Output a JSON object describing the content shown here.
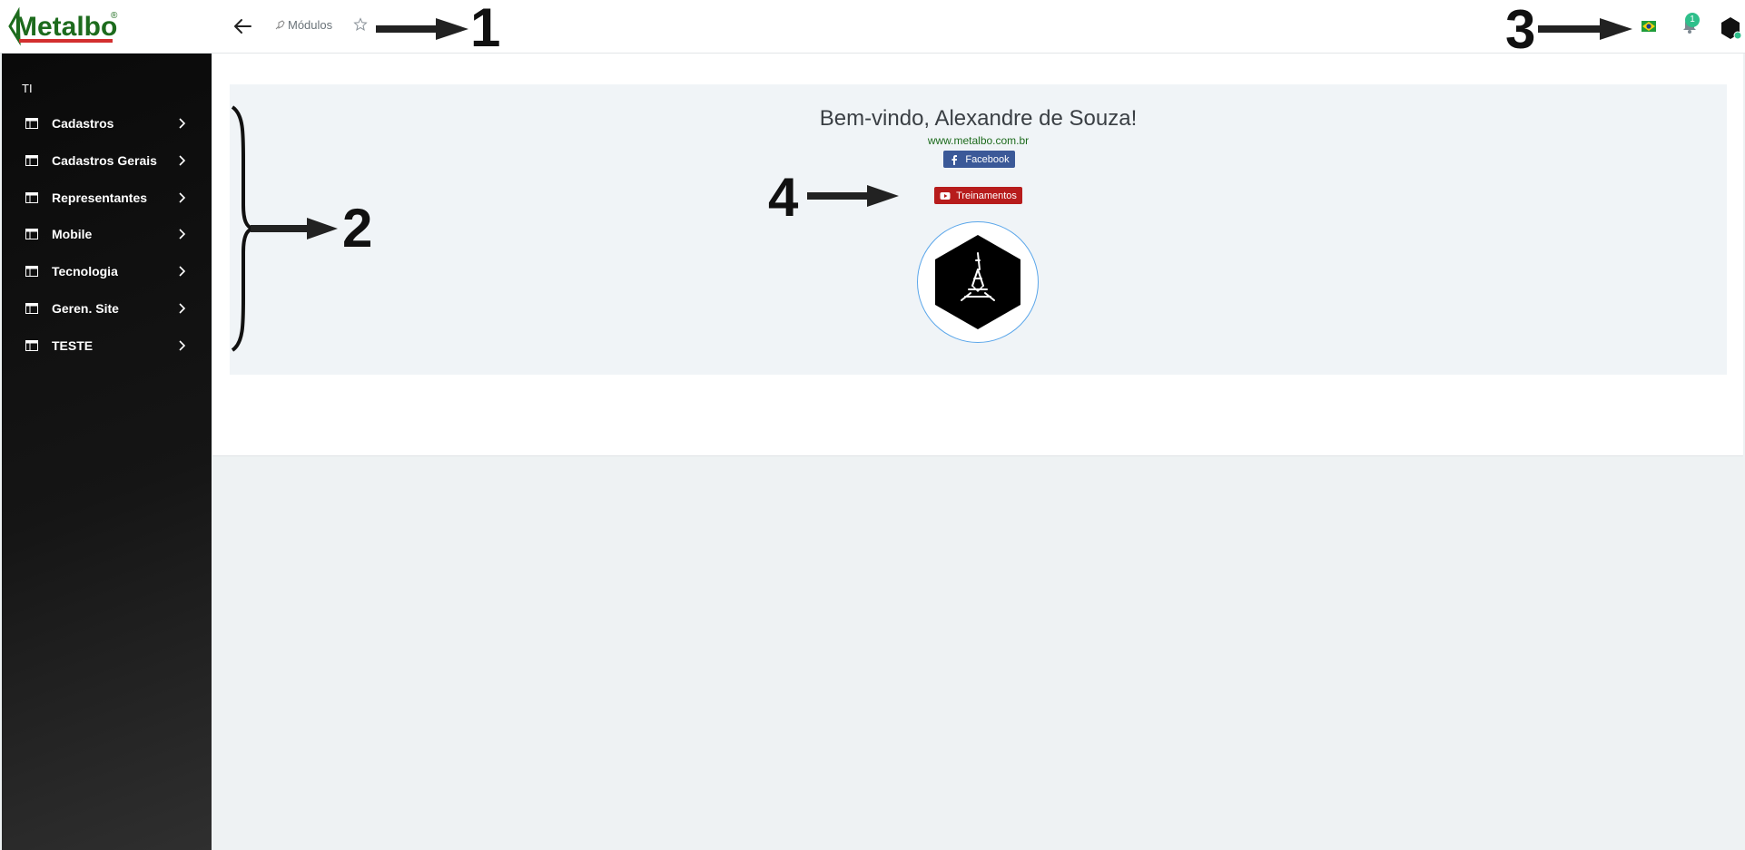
{
  "header": {
    "logo_text": "Metalbo",
    "logo_mark": "®",
    "back_icon": "arrow-left-icon",
    "breadcrumb_label": "Módulos",
    "favorite_icon": "star-icon",
    "language_icon": "brazil-flag-icon",
    "notifications_icon": "bell-icon",
    "notifications_count": "1",
    "user_icon": "user-avatar-icon"
  },
  "sidebar": {
    "section": "TI",
    "items": [
      {
        "label": "Cadastros"
      },
      {
        "label": "Cadastros Gerais"
      },
      {
        "label": "Representantes"
      },
      {
        "label": "Mobile"
      },
      {
        "label": "Tecnologia"
      },
      {
        "label": "Geren. Site"
      },
      {
        "label": "TESTE"
      }
    ]
  },
  "main": {
    "welcome": "Bem-vindo, Alexandre de Souza!",
    "site": "www.metalbo.com.br",
    "facebook_label": "Facebook",
    "trainings_label": "Treinamentos"
  },
  "annotations": [
    "1",
    "2",
    "3",
    "4"
  ],
  "colors": {
    "brand_green": "#1d6b1d",
    "brand_red": "#d32f2f",
    "sidebar_bg": "#0a0a0a",
    "facebook": "#3b5998",
    "youtube": "#b71c1c",
    "badge": "#2fbf8b"
  }
}
